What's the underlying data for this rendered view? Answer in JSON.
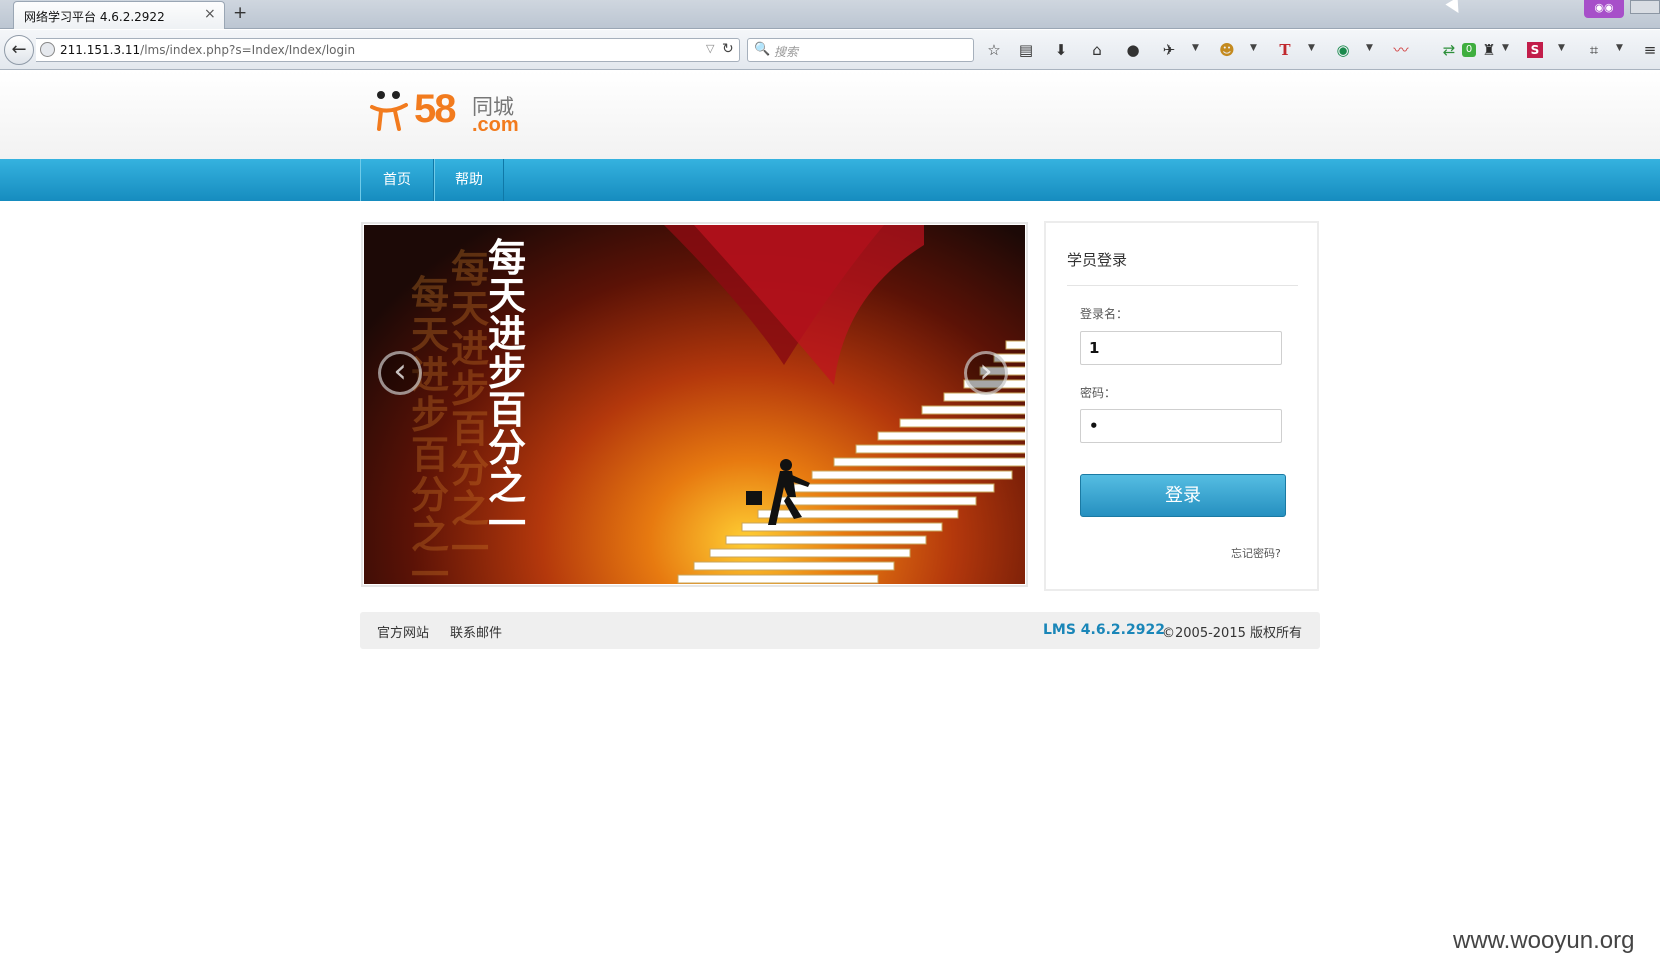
{
  "browser": {
    "tab_title": "网络学习平台 4.6.2.2922",
    "tab_close": "×",
    "new_tab": "+",
    "url_host": "211.151.3.11",
    "url_path": "/lms/index.php?s=Index/Index/login",
    "search_placeholder": "搜索",
    "toolbar_icons": [
      "star-icon",
      "reading-list-icon",
      "download-icon",
      "home-icon",
      "chat-icon",
      "plugin-icon",
      "monkey-icon",
      "translate-icon",
      "globe-icon",
      "graph-icon",
      "sync-icon",
      "android-icon",
      "s-icon",
      "crop-icon",
      "menu-icon"
    ],
    "badge_count": "0"
  },
  "site": {
    "logo_number": "58",
    "logo_text": "同城",
    "logo_domain": ".com"
  },
  "menu": {
    "home": "首页",
    "help": "帮助"
  },
  "banner": {
    "slogan": "每天进步百分之一",
    "prev": "‹",
    "next": "›"
  },
  "login": {
    "title": "学员登录",
    "username_label": "登录名：",
    "username_value": "1",
    "password_label": "密码：",
    "password_value": "1",
    "submit_label": "登录",
    "forgot_label": "忘记密码?"
  },
  "footer": {
    "official_site": "官方网站",
    "contact_email": "联系邮件",
    "version": "LMS 4.6.2.2922",
    "copyright": "©2005-2015 版权所有"
  },
  "watermark": "www.wooyun.org",
  "colors": {
    "menu_bar": "#1e9ccc",
    "brand_orange": "#f27b1e",
    "login_button": "#2f98c6",
    "version_text": "#1a86b8"
  }
}
